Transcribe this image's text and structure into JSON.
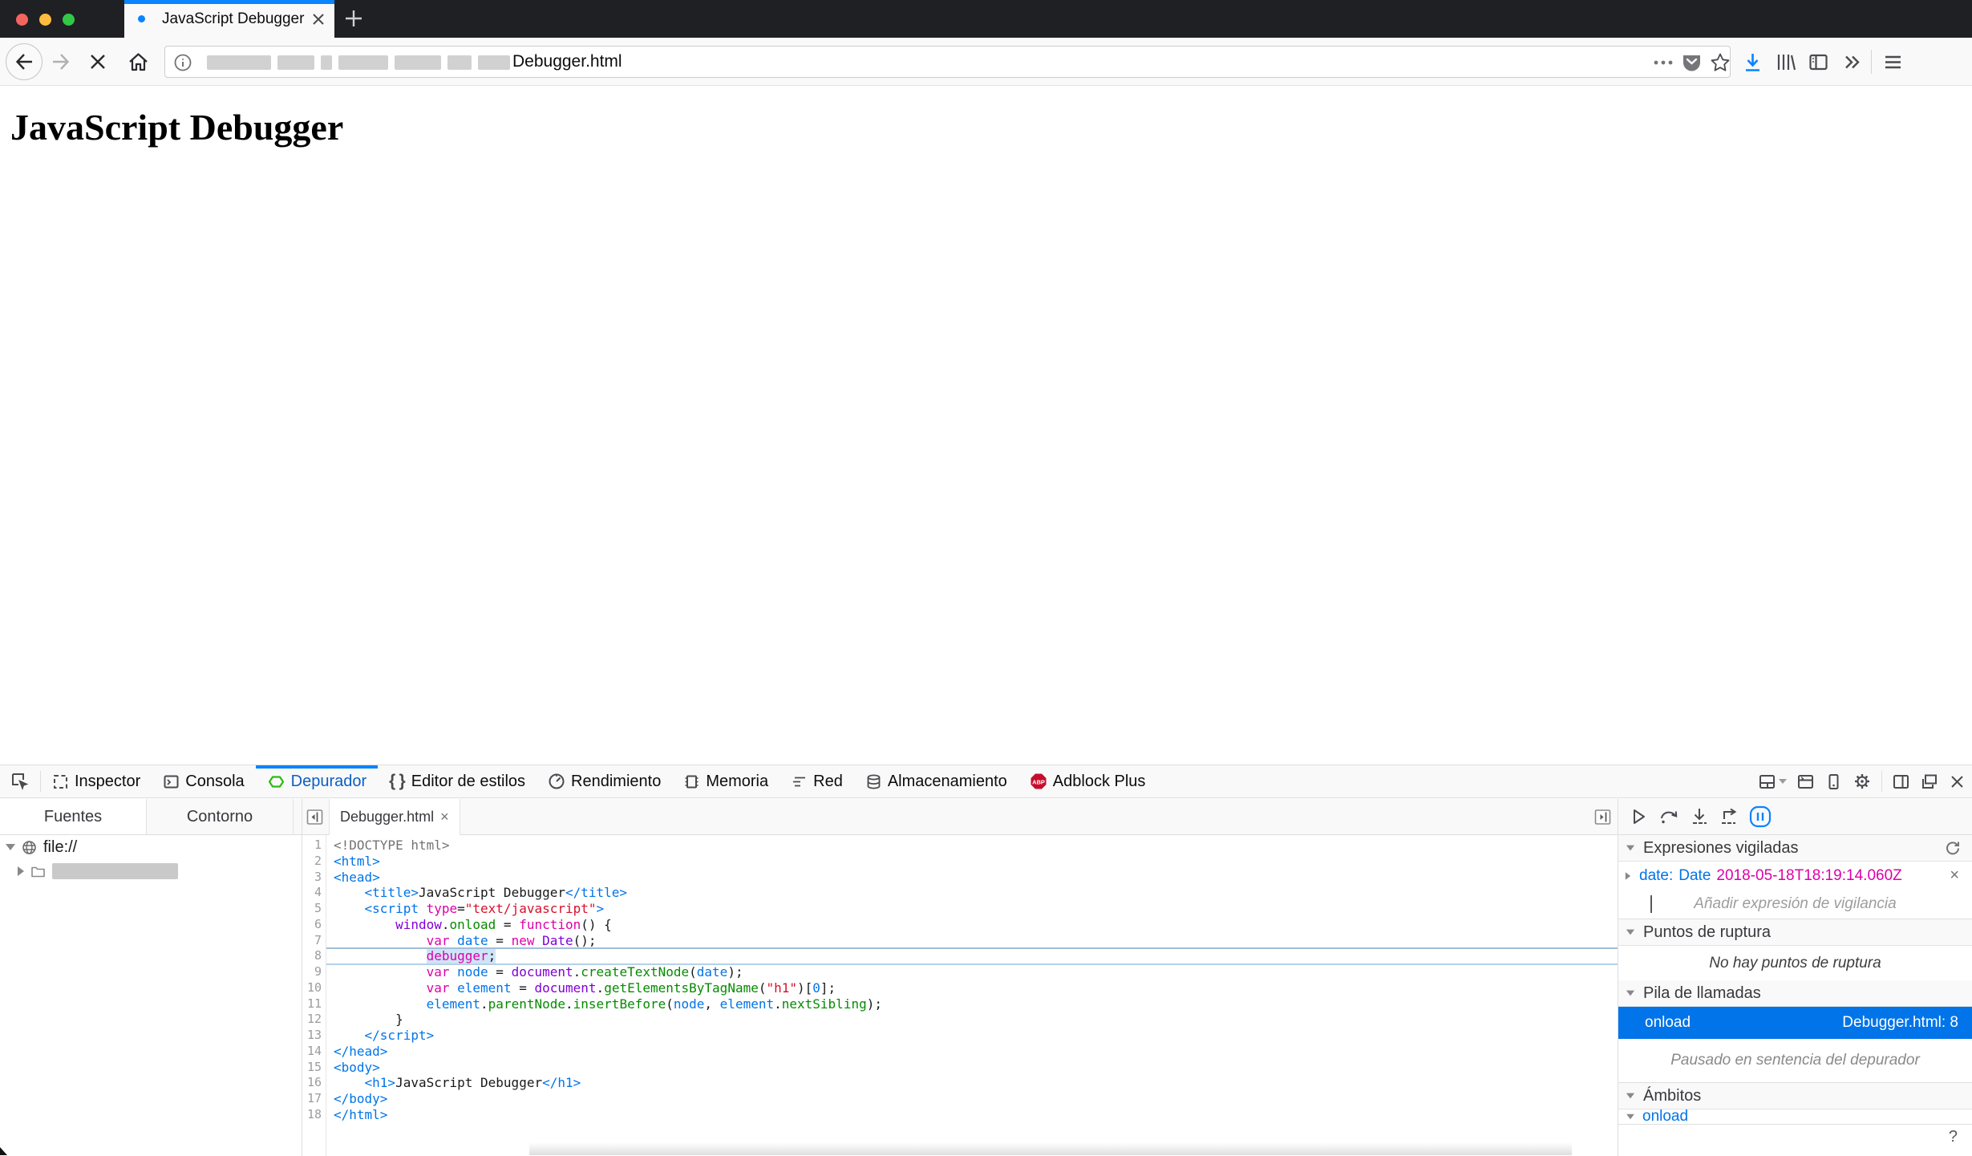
{
  "window": {
    "tab_title": "JavaScript Debugger",
    "traffic_lights": {
      "red": "#f4645f",
      "yellow": "#fdbc40",
      "green": "#33c748"
    }
  },
  "browser": {
    "url_visible_text": "Debugger.html",
    "accent_color": "#0a84ff"
  },
  "page": {
    "heading": "JavaScript Debugger"
  },
  "devtools": {
    "tabs": [
      {
        "label": "Inspector"
      },
      {
        "label": "Consola"
      },
      {
        "label": "Depurador",
        "active": true
      },
      {
        "label": "Editor de estilos"
      },
      {
        "label": "Rendimiento"
      },
      {
        "label": "Memoria"
      },
      {
        "label": "Red"
      },
      {
        "label": "Almacenamiento"
      },
      {
        "label": "Adblock Plus"
      }
    ],
    "sources": {
      "tab_fuentes": "Fuentes",
      "tab_contorno": "Contorno",
      "tree_root": "file://"
    },
    "editor": {
      "file_tab": "Debugger.html",
      "close": "×"
    },
    "right_panel": {
      "watch_header": "Expresiones vigiladas",
      "watch_name": "date",
      "watch_sep": ":",
      "watch_class": "Date",
      "watch_value": "2018-05-18T18:19:14.060Z",
      "watch_close": "×",
      "watch_placeholder": "Añadir expresión de vigilancia",
      "breakpoints_header": "Puntos de ruptura",
      "breakpoints_empty": "No hay puntos de ruptura",
      "callstack_header": "Pila de llamadas",
      "frame_name": "onload",
      "frame_location": "Debugger.html: 8",
      "paused_note": "Pausado en sentencia del depurador",
      "scopes_header": "Ámbitos",
      "scope_name": "onload",
      "help": "?"
    }
  },
  "code": {
    "paused_line": 8,
    "lines": [
      {
        "n": 1,
        "t": [
          [
            "m",
            "<!DOCTYPE html>"
          ]
        ]
      },
      {
        "n": 2,
        "t": [
          [
            "t",
            "<html>"
          ]
        ]
      },
      {
        "n": 3,
        "t": [
          [
            "t",
            "<head>"
          ]
        ]
      },
      {
        "n": 4,
        "t": [
          [
            "p",
            "    "
          ],
          [
            "t",
            "<title>"
          ],
          [
            "p",
            "JavaScript Debugger"
          ],
          [
            "t",
            "</title>"
          ]
        ]
      },
      {
        "n": 5,
        "t": [
          [
            "p",
            "    "
          ],
          [
            "t",
            "<script "
          ],
          [
            "a",
            "type"
          ],
          [
            "p",
            "="
          ],
          [
            "s",
            "\"text/javascript\""
          ],
          [
            "t",
            ">"
          ]
        ]
      },
      {
        "n": 6,
        "t": [
          [
            "p",
            "        "
          ],
          [
            "g",
            "window"
          ],
          [
            "p",
            "."
          ],
          [
            "f",
            "onload"
          ],
          [
            "p",
            " = "
          ],
          [
            "k",
            "function"
          ],
          [
            "p",
            "() {"
          ]
        ]
      },
      {
        "n": 7,
        "t": [
          [
            "p",
            "            "
          ],
          [
            "k",
            "var"
          ],
          [
            "p",
            " "
          ],
          [
            "d",
            "date"
          ],
          [
            "p",
            " = "
          ],
          [
            "k",
            "new"
          ],
          [
            "p",
            " "
          ],
          [
            "g",
            "Date"
          ],
          [
            "p",
            "();"
          ]
        ]
      },
      {
        "n": 8,
        "hl": true,
        "t": [
          [
            "p",
            "            "
          ],
          [
            "kx",
            "debugger"
          ],
          [
            "px",
            ";"
          ]
        ]
      },
      {
        "n": 9,
        "t": [
          [
            "p",
            "            "
          ],
          [
            "k",
            "var"
          ],
          [
            "p",
            " "
          ],
          [
            "d",
            "node"
          ],
          [
            "p",
            " = "
          ],
          [
            "g",
            "document"
          ],
          [
            "p",
            "."
          ],
          [
            "f",
            "createTextNode"
          ],
          [
            "p",
            "("
          ],
          [
            "d",
            "date"
          ],
          [
            "p",
            ");"
          ]
        ]
      },
      {
        "n": 10,
        "t": [
          [
            "p",
            "            "
          ],
          [
            "k",
            "var"
          ],
          [
            "p",
            " "
          ],
          [
            "d",
            "element"
          ],
          [
            "p",
            " = "
          ],
          [
            "g",
            "document"
          ],
          [
            "p",
            "."
          ],
          [
            "f",
            "getElementsByTagName"
          ],
          [
            "p",
            "("
          ],
          [
            "s",
            "\"h1\""
          ],
          [
            "p",
            ")["
          ],
          [
            "d",
            "0"
          ],
          [
            "p",
            "];"
          ]
        ]
      },
      {
        "n": 11,
        "t": [
          [
            "p",
            "            "
          ],
          [
            "d",
            "element"
          ],
          [
            "p",
            "."
          ],
          [
            "f",
            "parentNode"
          ],
          [
            "p",
            "."
          ],
          [
            "f",
            "insertBefore"
          ],
          [
            "p",
            "("
          ],
          [
            "d",
            "node"
          ],
          [
            "p",
            ", "
          ],
          [
            "d",
            "element"
          ],
          [
            "p",
            "."
          ],
          [
            "f",
            "nextSibling"
          ],
          [
            "p",
            ");"
          ]
        ]
      },
      {
        "n": 12,
        "t": [
          [
            "p",
            "        }"
          ]
        ]
      },
      {
        "n": 13,
        "t": [
          [
            "p",
            "    "
          ],
          [
            "t",
            "</script>"
          ]
        ]
      },
      {
        "n": 14,
        "t": [
          [
            "t",
            "</head>"
          ]
        ]
      },
      {
        "n": 15,
        "t": [
          [
            "t",
            "<body>"
          ]
        ]
      },
      {
        "n": 16,
        "t": [
          [
            "p",
            "    "
          ],
          [
            "t",
            "<h1>"
          ],
          [
            "p",
            "JavaScript Debugger"
          ],
          [
            "t",
            "</h1>"
          ]
        ]
      },
      {
        "n": 17,
        "t": [
          [
            "t",
            "</body>"
          ]
        ]
      },
      {
        "n": 18,
        "t": [
          [
            "t",
            "</html>"
          ]
        ]
      }
    ]
  }
}
